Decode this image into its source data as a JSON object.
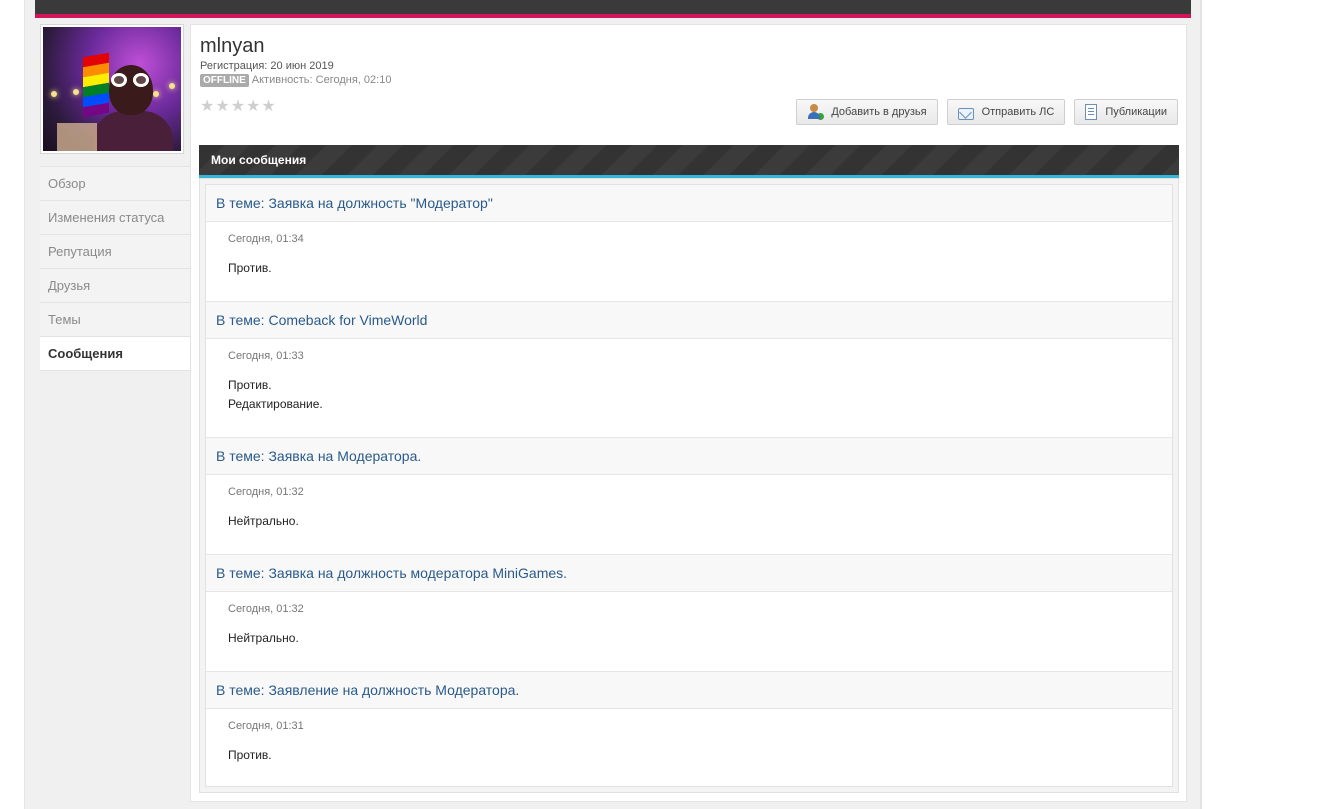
{
  "profile": {
    "username": "mlnyan",
    "registration": "Регистрация: 20 июн 2019",
    "status_badge": "OFFLINE",
    "activity": "Активность: Сегодня, 02:10",
    "rating_stars": 0,
    "rating_max": 5
  },
  "actions": {
    "add_friend": "Добавить в друзья",
    "send_pm": "Отправить ЛС",
    "publications": "Публикации"
  },
  "sidebar": {
    "items": [
      {
        "label": "Обзор",
        "active": false
      },
      {
        "label": "Изменения статуса",
        "active": false
      },
      {
        "label": "Репутация",
        "active": false
      },
      {
        "label": "Друзья",
        "active": false
      },
      {
        "label": "Темы",
        "active": false
      },
      {
        "label": "Сообщения",
        "active": true
      }
    ]
  },
  "section": {
    "title": "Мои сообщения"
  },
  "posts": [
    {
      "title": "В теме: Заявка на должность \"Модератор\"",
      "date": "Сегодня, 01:34",
      "lines": [
        "Против."
      ]
    },
    {
      "title": "В теме: Comeback for VimeWorld",
      "date": "Сегодня, 01:33",
      "lines": [
        "Против.",
        "Редактирование."
      ]
    },
    {
      "title": "В теме: Заявка на Модератора.",
      "date": "Сегодня, 01:32",
      "lines": [
        "Нейтрально."
      ]
    },
    {
      "title": "В теме: Заявка на должность модератора MiniGames.",
      "date": "Сегодня, 01:32",
      "lines": [
        "Нейтрально."
      ]
    },
    {
      "title": "В теме: Заявление на должность Модератора.",
      "date": "Сегодня, 01:31",
      "lines": [
        "Против."
      ]
    }
  ],
  "colors": {
    "accent_pink": "#d4145a",
    "accent_cyan": "#35b6d8",
    "link": "#2a5a8a"
  }
}
